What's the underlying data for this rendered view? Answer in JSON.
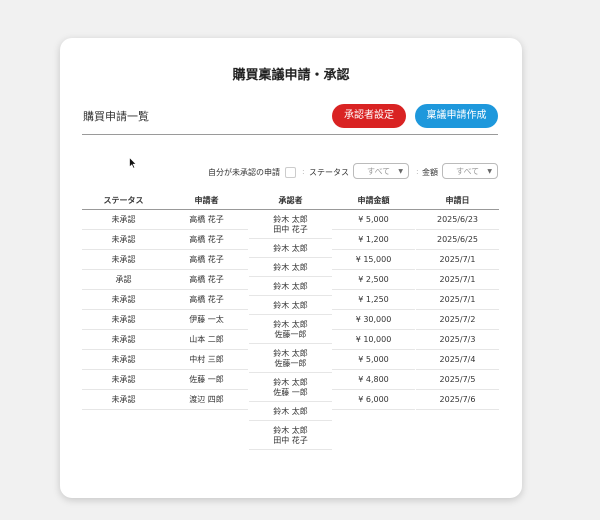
{
  "page": {
    "title": "購買稟議申請・承認",
    "subtitle": "購買申請一覧"
  },
  "buttons": {
    "approver_settings": "承認者設定",
    "create_request": "稟議申請作成"
  },
  "filters": {
    "unapproved_label": "自分が未承認の申請",
    "status_label": "ステータス",
    "status_value": "すべて",
    "amount_label": "金額",
    "amount_value": "すべて"
  },
  "table": {
    "headers": [
      "ステータス",
      "申請者",
      "承認者",
      "申請金額",
      "申請日"
    ],
    "status": [
      "未承認",
      "未承認",
      "未承認",
      "承認",
      "未承認",
      "未承認",
      "未承認",
      "未承認",
      "未承認",
      "未承認"
    ],
    "applicant": [
      "高橋 花子",
      "高橋 花子",
      "高橋 花子",
      "高橋 花子",
      "高橋 花子",
      "伊藤 一太",
      "山本 二郎",
      "中村 三郎",
      "佐藤 一郎",
      "渡辺 四郎"
    ],
    "approvers": [
      [
        "鈴木 太郎",
        "田中 花子"
      ],
      [
        "鈴木 太郎"
      ],
      [
        "鈴木 太郎"
      ],
      [
        "鈴木 太郎"
      ],
      [
        "鈴木 太郎"
      ],
      [
        "鈴木 太郎",
        "佐藤一郎"
      ],
      [
        "鈴木 太郎",
        "佐藤一郎"
      ],
      [
        "鈴木 太郎",
        "佐藤 一郎"
      ],
      [
        "鈴木 太郎"
      ],
      [
        "鈴木 太郎",
        "田中 花子"
      ]
    ],
    "amount": [
      "¥ 5,000",
      "¥ 1,200",
      "¥ 15,000",
      "¥ 2,500",
      "¥ 1,250",
      "¥ 30,000",
      "¥ 10,000",
      "¥ 5,000",
      "¥ 4,800",
      "¥ 6,000"
    ],
    "date": [
      "2025/6/23",
      "2025/6/25",
      "2025/7/1",
      "2025/7/1",
      "2025/7/1",
      "2025/7/2",
      "2025/7/3",
      "2025/7/4",
      "2025/7/5",
      "2025/7/6"
    ]
  },
  "colors": {
    "approver_button": "#d92323",
    "create_button": "#1e98dc"
  }
}
